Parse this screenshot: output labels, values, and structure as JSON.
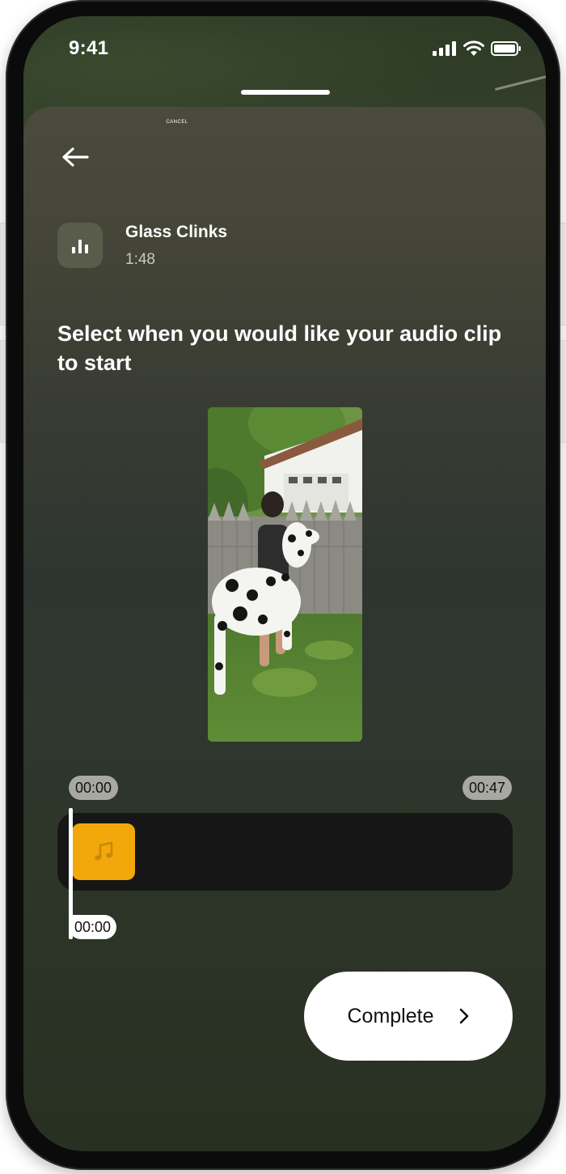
{
  "status_bar": {
    "time": "9:41"
  },
  "sheet": {
    "cancel_label": "CANCEL"
  },
  "track": {
    "title": "Glass Clinks",
    "duration": "1:48"
  },
  "instruction": "Select when you would like your audio clip to start",
  "timeline": {
    "start_time": "00:00",
    "end_time": "00:47",
    "playhead_time": "00:00",
    "playhead_position": 0.0
  },
  "actions": {
    "complete_label": "Complete"
  },
  "colors": {
    "accent_clip": "#f2a80a",
    "timeline_bg": "#161616",
    "button_bg": "#ffffff"
  },
  "icons": {
    "back": "arrow-left-icon",
    "track": "equalizer-bars-icon",
    "clip": "music-note-icon",
    "complete": "chevron-right-icon",
    "signal": "cellular-signal-icon",
    "wifi": "wifi-icon",
    "battery": "battery-icon"
  }
}
